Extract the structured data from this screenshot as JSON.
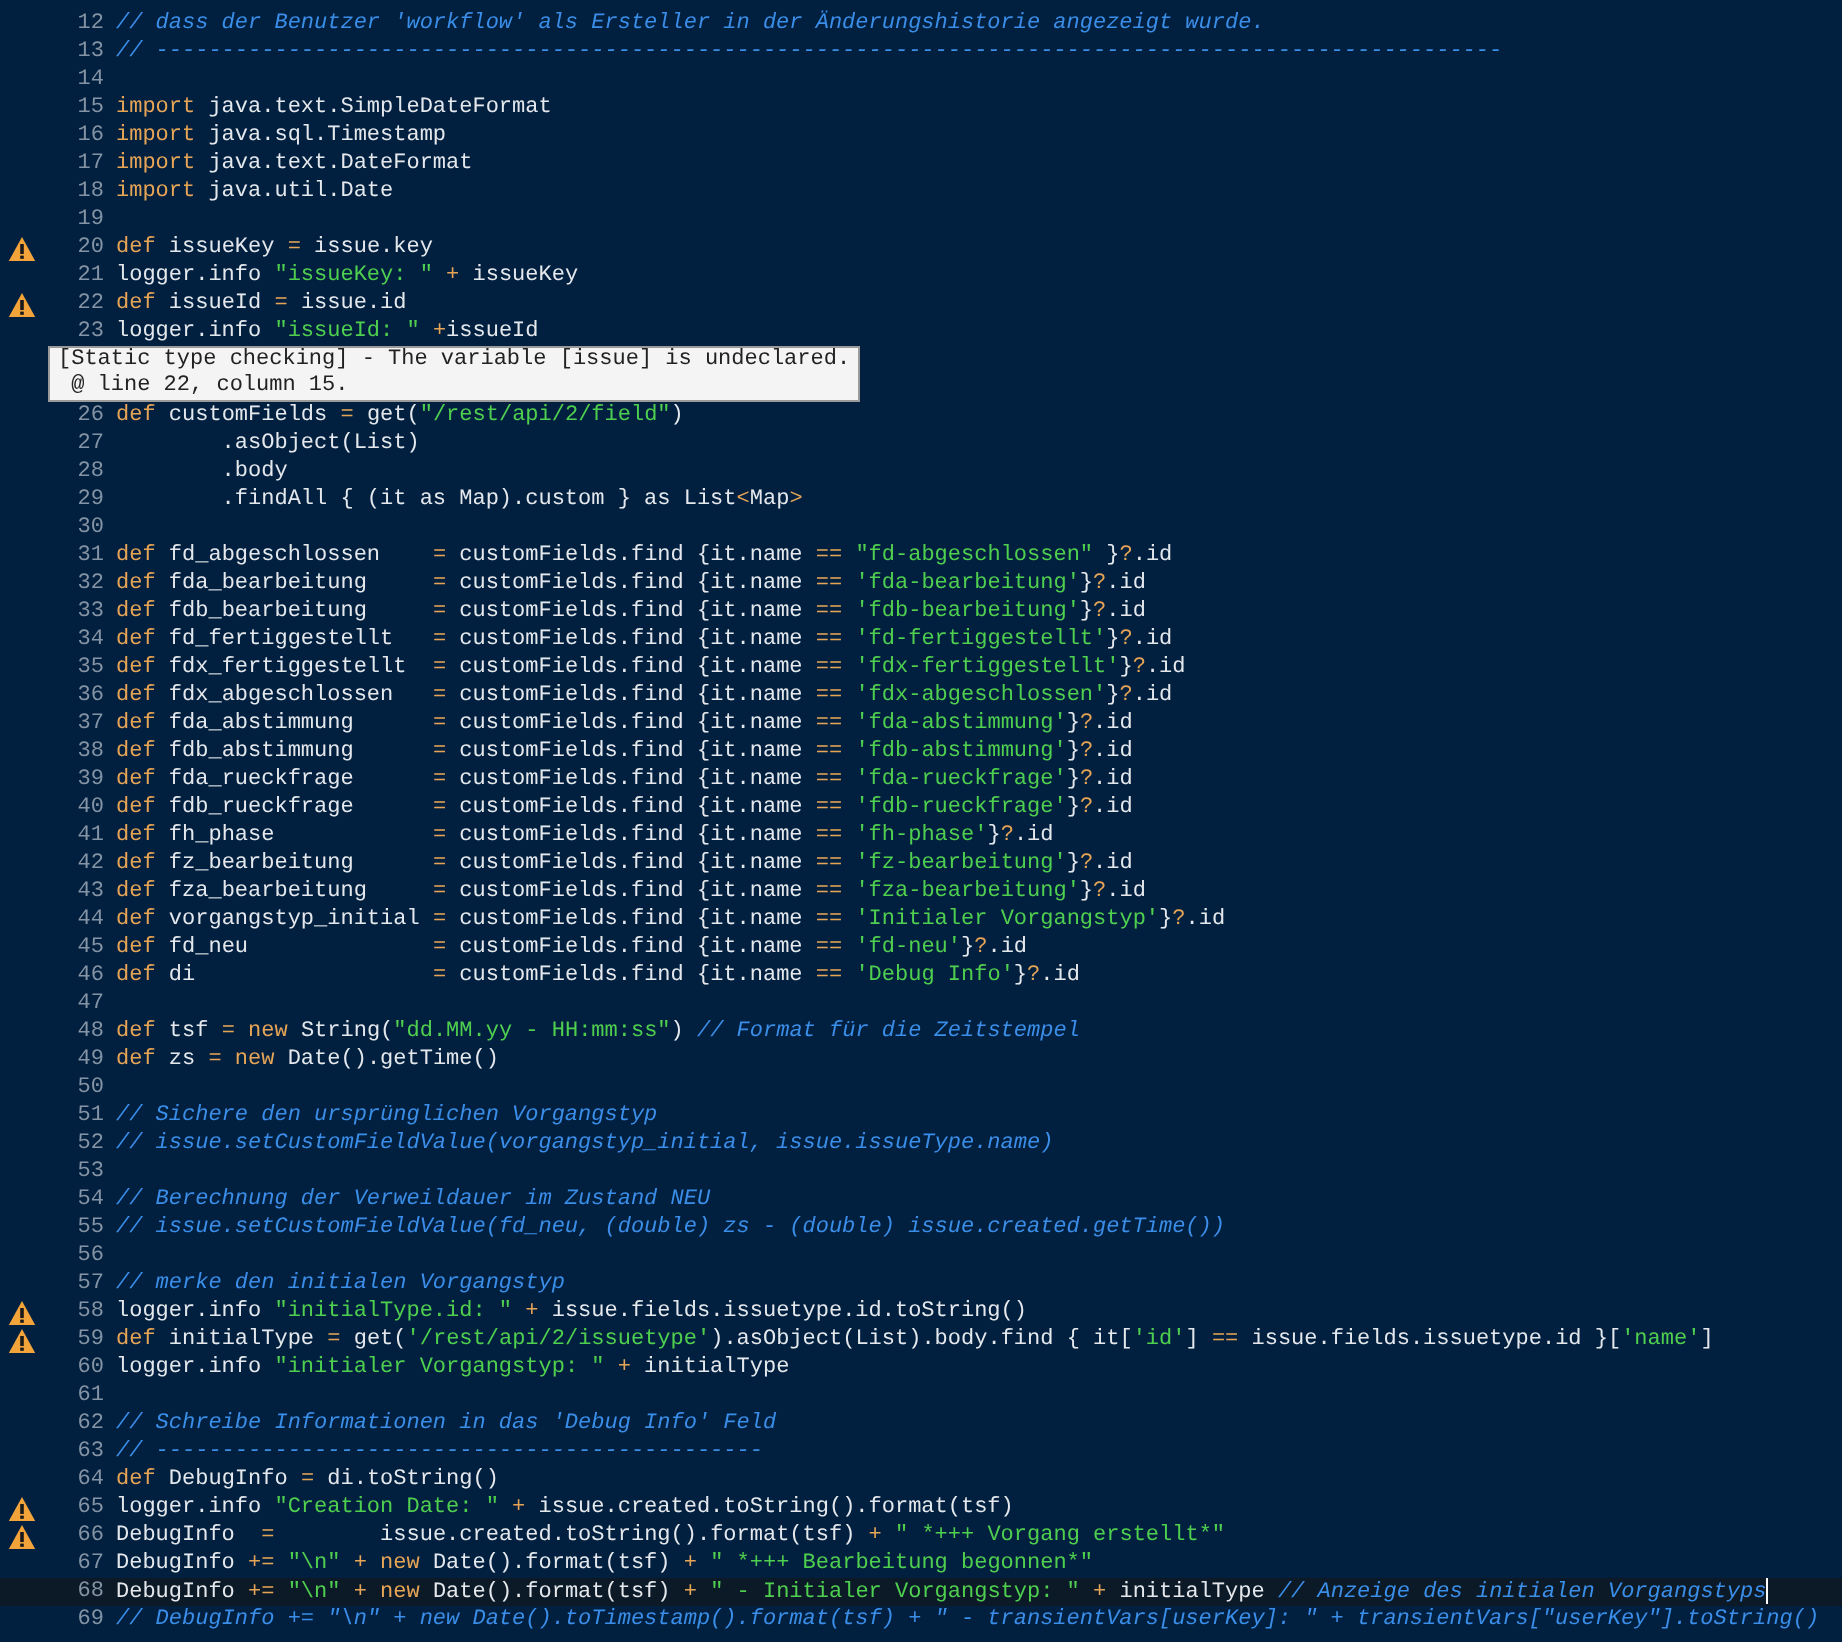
{
  "lines": [
    {
      "number": "12",
      "warning": false,
      "current": false,
      "cursor": false,
      "tokens": [
        {
          "kind": "comment",
          "text": "// dass der Benutzer 'workflow' als Ersteller in der Änderungshistorie angezeigt wurde."
        }
      ]
    },
    {
      "number": "13",
      "warning": false,
      "current": false,
      "cursor": false,
      "tokens": [
        {
          "kind": "comment",
          "text": "// ------------------------------------------------------------------------------------------------------"
        }
      ]
    },
    {
      "number": "14",
      "warning": false,
      "current": false,
      "cursor": false
    },
    {
      "number": "15",
      "warning": false,
      "current": false,
      "cursor": false,
      "tokens": [
        {
          "kind": "keyword",
          "text": "import"
        },
        {
          "kind": "plain",
          "text": " java.text.SimpleDateFormat"
        }
      ]
    },
    {
      "number": "16",
      "warning": false,
      "current": false,
      "cursor": false,
      "tokens": [
        {
          "kind": "keyword",
          "text": "import"
        },
        {
          "kind": "plain",
          "text": " java.sql.Timestamp"
        }
      ]
    },
    {
      "number": "17",
      "warning": false,
      "current": false,
      "cursor": false,
      "tokens": [
        {
          "kind": "keyword",
          "text": "import"
        },
        {
          "kind": "plain",
          "text": " java.text.DateFormat"
        }
      ]
    },
    {
      "number": "18",
      "warning": false,
      "current": false,
      "cursor": false,
      "tokens": [
        {
          "kind": "keyword",
          "text": "import"
        },
        {
          "kind": "plain",
          "text": " java.util.Date"
        }
      ]
    },
    {
      "number": "19",
      "warning": false,
      "current": false,
      "cursor": false
    },
    {
      "number": "20",
      "warning": true,
      "current": false,
      "cursor": false,
      "tokens": [
        {
          "kind": "keyword",
          "text": "def"
        },
        {
          "kind": "plain",
          "text": " issueKey "
        },
        {
          "kind": "operator",
          "text": "="
        },
        {
          "kind": "plain",
          "text": " issue.key"
        }
      ]
    },
    {
      "number": "21",
      "warning": false,
      "current": false,
      "cursor": false,
      "tokens": [
        {
          "kind": "plain",
          "text": "logger.info "
        },
        {
          "kind": "string",
          "text": "\"issueKey: \""
        },
        {
          "kind": "operator",
          "text": " +"
        },
        {
          "kind": "plain",
          "text": " issueKey"
        }
      ]
    },
    {
      "number": "22",
      "warning": true,
      "current": false,
      "cursor": false,
      "tokens": [
        {
          "kind": "keyword",
          "text": "def"
        },
        {
          "kind": "plain",
          "text": " issueId "
        },
        {
          "kind": "operator",
          "text": "="
        },
        {
          "kind": "plain",
          "text": " issue.id"
        }
      ]
    },
    {
      "number": "23",
      "warning": false,
      "current": false,
      "cursor": false,
      "tokens": [
        {
          "kind": "plain",
          "text": "logger.info "
        },
        {
          "kind": "string",
          "text": "\"issueId: \""
        },
        {
          "kind": "operator",
          "text": " +"
        },
        {
          "kind": "plain",
          "text": "issueId"
        }
      ]
    },
    {
      "tooltip": {
        "lines": [
          "[Static type checking] - The variable [issue] is undeclared.",
          " @ line 22, column 15."
        ]
      }
    },
    {
      "number": "26",
      "warning": false,
      "current": false,
      "cursor": false,
      "tokens": [
        {
          "kind": "keyword",
          "text": "def"
        },
        {
          "kind": "plain",
          "text": " customFields "
        },
        {
          "kind": "operator",
          "text": "="
        },
        {
          "kind": "plain",
          "text": " get("
        },
        {
          "kind": "string",
          "text": "\"/rest/api/2/field\""
        },
        {
          "kind": "plain",
          "text": ")"
        }
      ]
    },
    {
      "number": "27",
      "warning": false,
      "current": false,
      "cursor": false,
      "tokens": [
        {
          "kind": "plain",
          "text": "        .asObject(List)"
        }
      ]
    },
    {
      "number": "28",
      "warning": false,
      "current": false,
      "cursor": false,
      "tokens": [
        {
          "kind": "plain",
          "text": "        .body"
        }
      ]
    },
    {
      "number": "29",
      "warning": false,
      "current": false,
      "cursor": false,
      "tokens": [
        {
          "kind": "plain",
          "text": "        .findAll { (it as Map).custom } as List"
        },
        {
          "kind": "operator",
          "text": "<"
        },
        {
          "kind": "plain",
          "text": "Map"
        },
        {
          "kind": "operator",
          "text": ">"
        }
      ]
    },
    {
      "number": "30",
      "warning": false,
      "current": false,
      "cursor": false
    },
    {
      "number": "31",
      "warning": false,
      "current": false,
      "cursor": false,
      "tokens": [
        {
          "kind": "keyword",
          "text": "def"
        },
        {
          "kind": "plain",
          "text": " fd_abgeschlossen    "
        },
        {
          "kind": "operator",
          "text": "="
        },
        {
          "kind": "plain",
          "text": " customFields.find {it.name "
        },
        {
          "kind": "operator",
          "text": "== "
        },
        {
          "kind": "string",
          "text": "\"fd-abgeschlossen\""
        },
        {
          "kind": "plain",
          "text": " }"
        },
        {
          "kind": "operator",
          "text": "?"
        },
        {
          "kind": "plain",
          "text": ".id"
        }
      ]
    },
    {
      "number": "32",
      "warning": false,
      "current": false,
      "cursor": false,
      "tokens": [
        {
          "kind": "keyword",
          "text": "def"
        },
        {
          "kind": "plain",
          "text": " fda_bearbeitung     "
        },
        {
          "kind": "operator",
          "text": "="
        },
        {
          "kind": "plain",
          "text": " customFields.find {it.name "
        },
        {
          "kind": "operator",
          "text": "== "
        },
        {
          "kind": "string",
          "text": "'fda-bearbeitung'"
        },
        {
          "kind": "plain",
          "text": "}"
        },
        {
          "kind": "operator",
          "text": "?"
        },
        {
          "kind": "plain",
          "text": ".id"
        }
      ]
    },
    {
      "number": "33",
      "warning": false,
      "current": false,
      "cursor": false,
      "tokens": [
        {
          "kind": "keyword",
          "text": "def"
        },
        {
          "kind": "plain",
          "text": " fdb_bearbeitung     "
        },
        {
          "kind": "operator",
          "text": "="
        },
        {
          "kind": "plain",
          "text": " customFields.find {it.name "
        },
        {
          "kind": "operator",
          "text": "== "
        },
        {
          "kind": "string",
          "text": "'fdb-bearbeitung'"
        },
        {
          "kind": "plain",
          "text": "}"
        },
        {
          "kind": "operator",
          "text": "?"
        },
        {
          "kind": "plain",
          "text": ".id"
        }
      ]
    },
    {
      "number": "34",
      "warning": false,
      "current": false,
      "cursor": false,
      "tokens": [
        {
          "kind": "keyword",
          "text": "def"
        },
        {
          "kind": "plain",
          "text": " fd_fertiggestellt   "
        },
        {
          "kind": "operator",
          "text": "="
        },
        {
          "kind": "plain",
          "text": " customFields.find {it.name "
        },
        {
          "kind": "operator",
          "text": "== "
        },
        {
          "kind": "string",
          "text": "'fd-fertiggestellt'"
        },
        {
          "kind": "plain",
          "text": "}"
        },
        {
          "kind": "operator",
          "text": "?"
        },
        {
          "kind": "plain",
          "text": ".id"
        }
      ]
    },
    {
      "number": "35",
      "warning": false,
      "current": false,
      "cursor": false,
      "tokens": [
        {
          "kind": "keyword",
          "text": "def"
        },
        {
          "kind": "plain",
          "text": " fdx_fertiggestellt  "
        },
        {
          "kind": "operator",
          "text": "="
        },
        {
          "kind": "plain",
          "text": " customFields.find {it.name "
        },
        {
          "kind": "operator",
          "text": "== "
        },
        {
          "kind": "string",
          "text": "'fdx-fertiggestellt'"
        },
        {
          "kind": "plain",
          "text": "}"
        },
        {
          "kind": "operator",
          "text": "?"
        },
        {
          "kind": "plain",
          "text": ".id"
        }
      ]
    },
    {
      "number": "36",
      "warning": false,
      "current": false,
      "cursor": false,
      "tokens": [
        {
          "kind": "keyword",
          "text": "def"
        },
        {
          "kind": "plain",
          "text": " fdx_abgeschlossen   "
        },
        {
          "kind": "operator",
          "text": "="
        },
        {
          "kind": "plain",
          "text": " customFields.find {it.name "
        },
        {
          "kind": "operator",
          "text": "== "
        },
        {
          "kind": "string",
          "text": "'fdx-abgeschlossen'"
        },
        {
          "kind": "plain",
          "text": "}"
        },
        {
          "kind": "operator",
          "text": "?"
        },
        {
          "kind": "plain",
          "text": ".id"
        }
      ]
    },
    {
      "number": "37",
      "warning": false,
      "current": false,
      "cursor": false,
      "tokens": [
        {
          "kind": "keyword",
          "text": "def"
        },
        {
          "kind": "plain",
          "text": " fda_abstimmung      "
        },
        {
          "kind": "operator",
          "text": "="
        },
        {
          "kind": "plain",
          "text": " customFields.find {it.name "
        },
        {
          "kind": "operator",
          "text": "== "
        },
        {
          "kind": "string",
          "text": "'fda-abstimmung'"
        },
        {
          "kind": "plain",
          "text": "}"
        },
        {
          "kind": "operator",
          "text": "?"
        },
        {
          "kind": "plain",
          "text": ".id"
        }
      ]
    },
    {
      "number": "38",
      "warning": false,
      "current": false,
      "cursor": false,
      "tokens": [
        {
          "kind": "keyword",
          "text": "def"
        },
        {
          "kind": "plain",
          "text": " fdb_abstimmung      "
        },
        {
          "kind": "operator",
          "text": "="
        },
        {
          "kind": "plain",
          "text": " customFields.find {it.name "
        },
        {
          "kind": "operator",
          "text": "== "
        },
        {
          "kind": "string",
          "text": "'fdb-abstimmung'"
        },
        {
          "kind": "plain",
          "text": "}"
        },
        {
          "kind": "operator",
          "text": "?"
        },
        {
          "kind": "plain",
          "text": ".id"
        }
      ]
    },
    {
      "number": "39",
      "warning": false,
      "current": false,
      "cursor": false,
      "tokens": [
        {
          "kind": "keyword",
          "text": "def"
        },
        {
          "kind": "plain",
          "text": " fda_rueckfrage      "
        },
        {
          "kind": "operator",
          "text": "="
        },
        {
          "kind": "plain",
          "text": " customFields.find {it.name "
        },
        {
          "kind": "operator",
          "text": "== "
        },
        {
          "kind": "string",
          "text": "'fda-rueckfrage'"
        },
        {
          "kind": "plain",
          "text": "}"
        },
        {
          "kind": "operator",
          "text": "?"
        },
        {
          "kind": "plain",
          "text": ".id"
        }
      ]
    },
    {
      "number": "40",
      "warning": false,
      "current": false,
      "cursor": false,
      "tokens": [
        {
          "kind": "keyword",
          "text": "def"
        },
        {
          "kind": "plain",
          "text": " fdb_rueckfrage      "
        },
        {
          "kind": "operator",
          "text": "="
        },
        {
          "kind": "plain",
          "text": " customFields.find {it.name "
        },
        {
          "kind": "operator",
          "text": "== "
        },
        {
          "kind": "string",
          "text": "'fdb-rueckfrage'"
        },
        {
          "kind": "plain",
          "text": "}"
        },
        {
          "kind": "operator",
          "text": "?"
        },
        {
          "kind": "plain",
          "text": ".id"
        }
      ]
    },
    {
      "number": "41",
      "warning": false,
      "current": false,
      "cursor": false,
      "tokens": [
        {
          "kind": "keyword",
          "text": "def"
        },
        {
          "kind": "plain",
          "text": " fh_phase            "
        },
        {
          "kind": "operator",
          "text": "="
        },
        {
          "kind": "plain",
          "text": " customFields.find {it.name "
        },
        {
          "kind": "operator",
          "text": "== "
        },
        {
          "kind": "string",
          "text": "'fh-phase'"
        },
        {
          "kind": "plain",
          "text": "}"
        },
        {
          "kind": "operator",
          "text": "?"
        },
        {
          "kind": "plain",
          "text": ".id"
        }
      ]
    },
    {
      "number": "42",
      "warning": false,
      "current": false,
      "cursor": false,
      "tokens": [
        {
          "kind": "keyword",
          "text": "def"
        },
        {
          "kind": "plain",
          "text": " fz_bearbeitung      "
        },
        {
          "kind": "operator",
          "text": "="
        },
        {
          "kind": "plain",
          "text": " customFields.find {it.name "
        },
        {
          "kind": "operator",
          "text": "== "
        },
        {
          "kind": "string",
          "text": "'fz-bearbeitung'"
        },
        {
          "kind": "plain",
          "text": "}"
        },
        {
          "kind": "operator",
          "text": "?"
        },
        {
          "kind": "plain",
          "text": ".id"
        }
      ]
    },
    {
      "number": "43",
      "warning": false,
      "current": false,
      "cursor": false,
      "tokens": [
        {
          "kind": "keyword",
          "text": "def"
        },
        {
          "kind": "plain",
          "text": " fza_bearbeitung     "
        },
        {
          "kind": "operator",
          "text": "="
        },
        {
          "kind": "plain",
          "text": " customFields.find {it.name "
        },
        {
          "kind": "operator",
          "text": "== "
        },
        {
          "kind": "string",
          "text": "'fza-bearbeitung'"
        },
        {
          "kind": "plain",
          "text": "}"
        },
        {
          "kind": "operator",
          "text": "?"
        },
        {
          "kind": "plain",
          "text": ".id"
        }
      ]
    },
    {
      "number": "44",
      "warning": false,
      "current": false,
      "cursor": false,
      "tokens": [
        {
          "kind": "keyword",
          "text": "def"
        },
        {
          "kind": "plain",
          "text": " vorgangstyp_initial "
        },
        {
          "kind": "operator",
          "text": "="
        },
        {
          "kind": "plain",
          "text": " customFields.find {it.name "
        },
        {
          "kind": "operator",
          "text": "== "
        },
        {
          "kind": "string",
          "text": "'Initialer Vorgangstyp'"
        },
        {
          "kind": "plain",
          "text": "}"
        },
        {
          "kind": "operator",
          "text": "?"
        },
        {
          "kind": "plain",
          "text": ".id"
        }
      ]
    },
    {
      "number": "45",
      "warning": false,
      "current": false,
      "cursor": false,
      "tokens": [
        {
          "kind": "keyword",
          "text": "def"
        },
        {
          "kind": "plain",
          "text": " fd_neu              "
        },
        {
          "kind": "operator",
          "text": "="
        },
        {
          "kind": "plain",
          "text": " customFields.find {it.name "
        },
        {
          "kind": "operator",
          "text": "== "
        },
        {
          "kind": "string",
          "text": "'fd-neu'"
        },
        {
          "kind": "plain",
          "text": "}"
        },
        {
          "kind": "operator",
          "text": "?"
        },
        {
          "kind": "plain",
          "text": ".id"
        }
      ]
    },
    {
      "number": "46",
      "warning": false,
      "current": false,
      "cursor": false,
      "tokens": [
        {
          "kind": "keyword",
          "text": "def"
        },
        {
          "kind": "plain",
          "text": " di                  "
        },
        {
          "kind": "operator",
          "text": "="
        },
        {
          "kind": "plain",
          "text": " customFields.find {it.name "
        },
        {
          "kind": "operator",
          "text": "== "
        },
        {
          "kind": "string",
          "text": "'Debug Info'"
        },
        {
          "kind": "plain",
          "text": "}"
        },
        {
          "kind": "operator",
          "text": "?"
        },
        {
          "kind": "plain",
          "text": ".id"
        }
      ]
    },
    {
      "number": "47",
      "warning": false,
      "current": false,
      "cursor": false
    },
    {
      "number": "48",
      "warning": false,
      "current": false,
      "cursor": false,
      "tokens": [
        {
          "kind": "keyword",
          "text": "def"
        },
        {
          "kind": "plain",
          "text": " tsf "
        },
        {
          "kind": "operator",
          "text": "="
        },
        {
          "kind": "keyword",
          "text": " new"
        },
        {
          "kind": "plain",
          "text": " String("
        },
        {
          "kind": "string",
          "text": "\"dd.MM.yy - HH:mm:ss\""
        },
        {
          "kind": "plain",
          "text": ") "
        },
        {
          "kind": "comment",
          "text": "// Format für die Zeitstempel"
        }
      ]
    },
    {
      "number": "49",
      "warning": false,
      "current": false,
      "cursor": false,
      "tokens": [
        {
          "kind": "keyword",
          "text": "def"
        },
        {
          "kind": "plain",
          "text": " zs "
        },
        {
          "kind": "operator",
          "text": "="
        },
        {
          "kind": "keyword",
          "text": " new"
        },
        {
          "kind": "plain",
          "text": " Date().getTime()"
        }
      ]
    },
    {
      "number": "50",
      "warning": false,
      "current": false,
      "cursor": false
    },
    {
      "number": "51",
      "warning": false,
      "current": false,
      "cursor": false,
      "tokens": [
        {
          "kind": "comment",
          "text": "// Sichere den ursprünglichen Vorgangstyp"
        }
      ]
    },
    {
      "number": "52",
      "warning": false,
      "current": false,
      "cursor": false,
      "tokens": [
        {
          "kind": "comment",
          "text": "// issue.setCustomFieldValue(vorgangstyp_initial, issue.issueType.name)"
        }
      ]
    },
    {
      "number": "53",
      "warning": false,
      "current": false,
      "cursor": false
    },
    {
      "number": "54",
      "warning": false,
      "current": false,
      "cursor": false,
      "tokens": [
        {
          "kind": "comment",
          "text": "// Berechnung der Verweildauer im Zustand NEU"
        }
      ]
    },
    {
      "number": "55",
      "warning": false,
      "current": false,
      "cursor": false,
      "tokens": [
        {
          "kind": "comment",
          "text": "// issue.setCustomFieldValue(fd_neu, (double) zs - (double) issue.created.getTime())"
        }
      ]
    },
    {
      "number": "56",
      "warning": false,
      "current": false,
      "cursor": false
    },
    {
      "number": "57",
      "warning": false,
      "current": false,
      "cursor": false,
      "tokens": [
        {
          "kind": "comment",
          "text": "// merke den initialen Vorgangstyp"
        }
      ]
    },
    {
      "number": "58",
      "warning": true,
      "current": false,
      "cursor": false,
      "tokens": [
        {
          "kind": "plain",
          "text": "logger.info "
        },
        {
          "kind": "string",
          "text": "\"initialType.id: \""
        },
        {
          "kind": "operator",
          "text": " +"
        },
        {
          "kind": "plain",
          "text": " issue.fields.issuetype.id.toString()"
        }
      ]
    },
    {
      "number": "59",
      "warning": true,
      "current": false,
      "cursor": false,
      "tokens": [
        {
          "kind": "keyword",
          "text": "def"
        },
        {
          "kind": "plain",
          "text": " initialType "
        },
        {
          "kind": "operator",
          "text": "="
        },
        {
          "kind": "plain",
          "text": " get("
        },
        {
          "kind": "string",
          "text": "'/rest/api/2/issuetype'"
        },
        {
          "kind": "plain",
          "text": ").asObject(List).body.find { it["
        },
        {
          "kind": "string",
          "text": "'id'"
        },
        {
          "kind": "plain",
          "text": "] "
        },
        {
          "kind": "operator",
          "text": "=="
        },
        {
          "kind": "plain",
          "text": " issue.fields.issuetype.id }["
        },
        {
          "kind": "string",
          "text": "'name'"
        },
        {
          "kind": "plain",
          "text": "]"
        }
      ]
    },
    {
      "number": "60",
      "warning": false,
      "current": false,
      "cursor": false,
      "tokens": [
        {
          "kind": "plain",
          "text": "logger.info "
        },
        {
          "kind": "string",
          "text": "\"initialer Vorgangstyp: \""
        },
        {
          "kind": "operator",
          "text": " +"
        },
        {
          "kind": "plain",
          "text": " initialType"
        }
      ]
    },
    {
      "number": "61",
      "warning": false,
      "current": false,
      "cursor": false
    },
    {
      "number": "62",
      "warning": false,
      "current": false,
      "cursor": false,
      "tokens": [
        {
          "kind": "comment",
          "text": "// Schreibe Informationen in das 'Debug Info' Feld"
        }
      ]
    },
    {
      "number": "63",
      "warning": false,
      "current": false,
      "cursor": false,
      "tokens": [
        {
          "kind": "comment",
          "text": "// ----------------------------------------------"
        }
      ]
    },
    {
      "number": "64",
      "warning": false,
      "current": false,
      "cursor": false,
      "tokens": [
        {
          "kind": "keyword",
          "text": "def"
        },
        {
          "kind": "plain",
          "text": " DebugInfo "
        },
        {
          "kind": "operator",
          "text": "="
        },
        {
          "kind": "plain",
          "text": " di.toString()"
        }
      ]
    },
    {
      "number": "65",
      "warning": true,
      "current": false,
      "cursor": false,
      "tokens": [
        {
          "kind": "plain",
          "text": "logger.info "
        },
        {
          "kind": "string",
          "text": "\"Creation Date: \""
        },
        {
          "kind": "operator",
          "text": " +"
        },
        {
          "kind": "plain",
          "text": " issue.created.toString().format(tsf)"
        }
      ]
    },
    {
      "number": "66",
      "warning": true,
      "current": false,
      "cursor": false,
      "tokens": [
        {
          "kind": "plain",
          "text": "DebugInfo  "
        },
        {
          "kind": "operator",
          "text": "="
        },
        {
          "kind": "plain",
          "text": "        issue.created.toString().format(tsf) "
        },
        {
          "kind": "operator",
          "text": "+ "
        },
        {
          "kind": "string",
          "text": "\" *+++ Vorgang erstellt*\""
        }
      ]
    },
    {
      "number": "67",
      "warning": false,
      "current": false,
      "cursor": false,
      "tokens": [
        {
          "kind": "plain",
          "text": "DebugInfo "
        },
        {
          "kind": "operator",
          "text": "+= "
        },
        {
          "kind": "string",
          "text": "\"\\n\""
        },
        {
          "kind": "operator",
          "text": " +"
        },
        {
          "kind": "keyword",
          "text": " new"
        },
        {
          "kind": "plain",
          "text": " Date().format(tsf) "
        },
        {
          "kind": "operator",
          "text": "+ "
        },
        {
          "kind": "string",
          "text": "\" *+++ Bearbeitung begonnen*\""
        }
      ]
    },
    {
      "number": "68",
      "warning": false,
      "current": true,
      "cursor": true,
      "tokens": [
        {
          "kind": "plain",
          "text": "DebugInfo "
        },
        {
          "kind": "operator",
          "text": "+= "
        },
        {
          "kind": "string",
          "text": "\"\\n\""
        },
        {
          "kind": "operator",
          "text": " +"
        },
        {
          "kind": "keyword",
          "text": " new"
        },
        {
          "kind": "plain",
          "text": " Date().format(tsf) "
        },
        {
          "kind": "operator",
          "text": "+ "
        },
        {
          "kind": "string",
          "text": "\" - Initialer Vorgangstyp: \""
        },
        {
          "kind": "operator",
          "text": " +"
        },
        {
          "kind": "plain",
          "text": " initialType "
        },
        {
          "kind": "comment",
          "text": "// Anzeige des initialen Vorgangstyps"
        }
      ]
    },
    {
      "number": "69",
      "warning": false,
      "current": false,
      "cursor": false,
      "tokens": [
        {
          "kind": "comment",
          "text": "// DebugInfo += \"\\n\" + new Date().toTimestamp().format(tsf) + \" - transientVars[userKey]: \" + transientVars[\"userKey\"].toString()"
        }
      ]
    }
  ]
}
